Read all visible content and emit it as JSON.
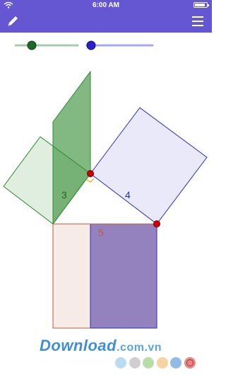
{
  "status_bar": {
    "time": "6:00 AM",
    "wifi_icon": "wifi-icon",
    "battery_level": 0.9
  },
  "toolbar": {
    "left_icon": "pencil-icon",
    "right_icon": "menu-icon",
    "color": "#6557d2"
  },
  "sliders": [
    {
      "name": "slider-1",
      "value": 0.27,
      "color": "#1a6b2a",
      "track": "#a8c8b0"
    },
    {
      "name": "slider-2",
      "value": 0.09,
      "color": "#2d1fd0",
      "track": "#a8a8ea"
    }
  ],
  "figure": {
    "labels": {
      "green": "3",
      "blue": "4",
      "brown": "5"
    },
    "colors": {
      "green": "#2e8b2e",
      "blue": "#2d2dbd",
      "brown": "#c0583a",
      "point": "#cc0000",
      "right_angle": "#e7a600"
    }
  },
  "watermark": {
    "brand": "Download",
    "domain": ".com.vn"
  },
  "palette": [
    {
      "color": "#b9dcf2",
      "name": "light-blue"
    },
    {
      "color": "#cfcfcf",
      "name": "grey"
    },
    {
      "color": "#b8dea7",
      "name": "light-green"
    },
    {
      "color": "#f6d4a0",
      "name": "light-orange"
    },
    {
      "color": "#8fbbe5",
      "name": "blue"
    },
    {
      "color": "#e58787",
      "name": "red"
    }
  ]
}
